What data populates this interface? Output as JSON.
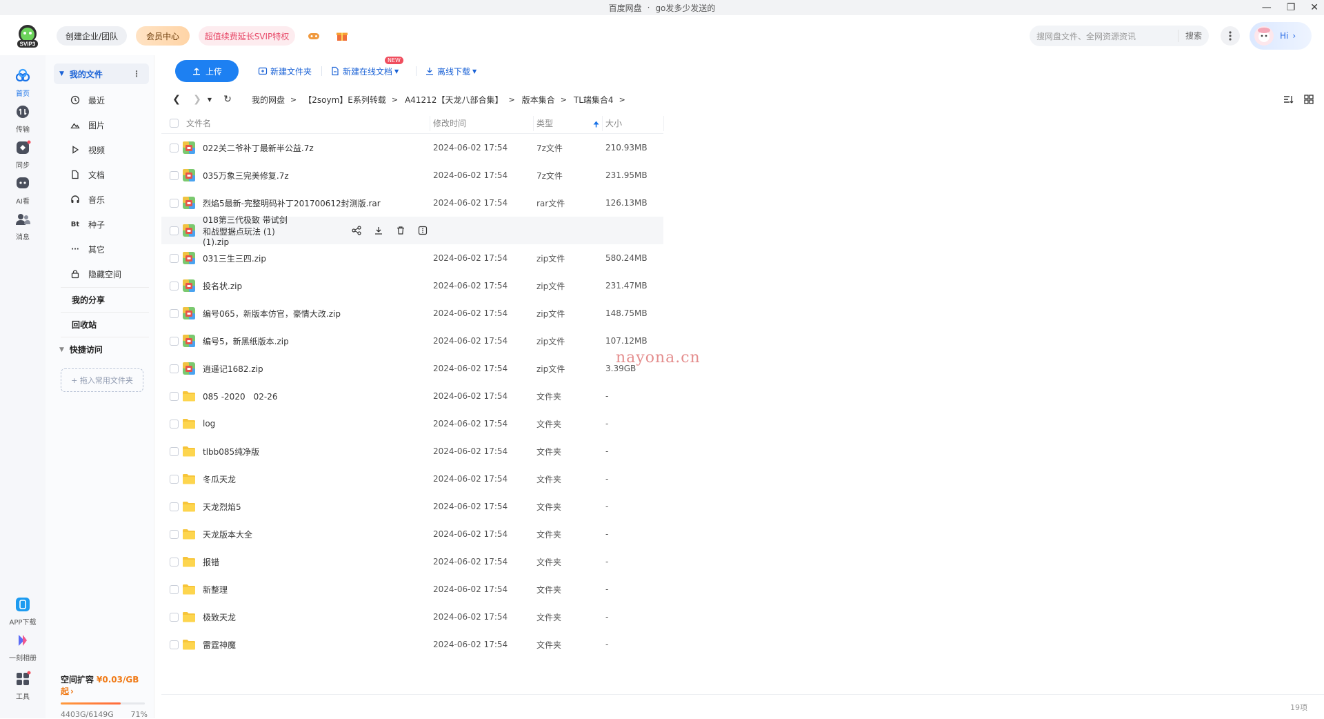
{
  "window": {
    "title": "百度网盘",
    "separator": "·",
    "subtitle": "go发多少发送的"
  },
  "header": {
    "logo_badge": "SVIP3",
    "team_button": "创建企业/团队",
    "vip_button": "会员中心",
    "svip_promo": "超值续费延长SVIP特权",
    "search_placeholder": "搜网盘文件、全网资源资讯",
    "search_button": "搜索",
    "greeting": "Hi"
  },
  "rail": {
    "items": [
      {
        "label": "首页",
        "icon": "cloud-home-icon"
      },
      {
        "label": "传输",
        "icon": "transfer-icon"
      },
      {
        "label": "同步",
        "icon": "sync-icon"
      },
      {
        "label": "AI看",
        "icon": "ai-icon"
      },
      {
        "label": "消息",
        "icon": "message-icon"
      }
    ],
    "bottom": [
      {
        "label": "APP下载",
        "icon": "app-download-icon"
      },
      {
        "label": "一刻相册",
        "icon": "album-icon"
      },
      {
        "label": "工具",
        "icon": "tools-icon"
      }
    ]
  },
  "sidebar": {
    "my_files": "我的文件",
    "items": [
      {
        "label": "最近",
        "icon": "clock-icon"
      },
      {
        "label": "图片",
        "icon": "image-icon"
      },
      {
        "label": "视频",
        "icon": "play-icon"
      },
      {
        "label": "文档",
        "icon": "document-icon"
      },
      {
        "label": "音乐",
        "icon": "headphones-icon"
      },
      {
        "label": "种子",
        "icon": "bt-icon",
        "glyph": "Bt"
      },
      {
        "label": "其它",
        "icon": "more-icon",
        "glyph": "···"
      },
      {
        "label": "隐藏空间",
        "icon": "lock-icon"
      }
    ],
    "my_share": "我的分享",
    "recycle_bin": "回收站",
    "quick_access": "快捷访问",
    "drop_hint": "+ 拖入常用文件夹",
    "storage": {
      "title": "空间扩容",
      "price": "¥0.03/GB起",
      "arrow": "›",
      "used": "4403G/6149G",
      "percent": "71%",
      "fill_fraction": 0.71
    }
  },
  "toolbar": {
    "upload": "上传",
    "new_folder": "新建文件夹",
    "new_online_doc": "新建在线文档",
    "new_badge": "NEW",
    "offline_download": "离线下载"
  },
  "breadcrumb": [
    "我的网盘",
    "【2soym】E系列转载",
    "A41212【天龙八部合集】",
    "版本集合",
    "TL端集合4"
  ],
  "table": {
    "headers": {
      "name": "文件名",
      "time": "修改时间",
      "type": "类型",
      "size": "大小"
    },
    "rows": [
      {
        "name": "022关二爷补丁最新半公益.7z",
        "time": "2024-06-02 17:54",
        "type": "7z文件",
        "size": "210.93MB",
        "kind": "archive"
      },
      {
        "name": "035万象三完美修复.7z",
        "time": "2024-06-02 17:54",
        "type": "7z文件",
        "size": "231.95MB",
        "kind": "archive"
      },
      {
        "name": "烈焰5最新-完整明码补丁201700612封测版.rar",
        "time": "2024-06-02 17:54",
        "type": "rar文件",
        "size": "126.13MB",
        "kind": "archive"
      },
      {
        "name": "018第三代极致 带试剑和战盟据点玩法 (1)(1).zip",
        "time": "",
        "type": "",
        "size": "",
        "kind": "archive",
        "hover": true
      },
      {
        "name": "031三生三四.zip",
        "time": "2024-06-02 17:54",
        "type": "zip文件",
        "size": "580.24MB",
        "kind": "archive"
      },
      {
        "name": "投名状.zip",
        "time": "2024-06-02 17:54",
        "type": "zip文件",
        "size": "231.47MB",
        "kind": "archive"
      },
      {
        "name": "编号065，新版本仿官，豪情大改.zip",
        "time": "2024-06-02 17:54",
        "type": "zip文件",
        "size": "148.75MB",
        "kind": "archive"
      },
      {
        "name": "编号5，新黑纸版本.zip",
        "time": "2024-06-02 17:54",
        "type": "zip文件",
        "size": "107.12MB",
        "kind": "archive"
      },
      {
        "name": "逍遥记1682.zip",
        "time": "2024-06-02 17:54",
        "type": "zip文件",
        "size": "3.39GB",
        "kind": "archive"
      },
      {
        "name": "085 -2020　02-26",
        "time": "2024-06-02 17:54",
        "type": "文件夹",
        "size": "-",
        "kind": "folder"
      },
      {
        "name": "log",
        "time": "2024-06-02 17:54",
        "type": "文件夹",
        "size": "-",
        "kind": "folder"
      },
      {
        "name": "tlbb085纯净版",
        "time": "2024-06-02 17:54",
        "type": "文件夹",
        "size": "-",
        "kind": "folder"
      },
      {
        "name": "冬瓜天龙",
        "time": "2024-06-02 17:54",
        "type": "文件夹",
        "size": "-",
        "kind": "folder"
      },
      {
        "name": "天龙烈焰5",
        "time": "2024-06-02 17:54",
        "type": "文件夹",
        "size": "-",
        "kind": "folder"
      },
      {
        "name": "天龙版本大全",
        "time": "2024-06-02 17:54",
        "type": "文件夹",
        "size": "-",
        "kind": "folder"
      },
      {
        "name": "报错",
        "time": "2024-06-02 17:54",
        "type": "文件夹",
        "size": "-",
        "kind": "folder"
      },
      {
        "name": "新整理",
        "time": "2024-06-02 17:54",
        "type": "文件夹",
        "size": "-",
        "kind": "folder"
      },
      {
        "name": "极致天龙",
        "time": "2024-06-02 17:54",
        "type": "文件夹",
        "size": "-",
        "kind": "folder"
      },
      {
        "name": "雷霆神魔",
        "time": "2024-06-02 17:54",
        "type": "文件夹",
        "size": "-",
        "kind": "folder"
      }
    ]
  },
  "status": {
    "count": "19项"
  },
  "watermark": "nayona.cn",
  "colors": {
    "accent": "#1d80f2",
    "svip": "#e84b6a",
    "storage": "#f07a16"
  }
}
